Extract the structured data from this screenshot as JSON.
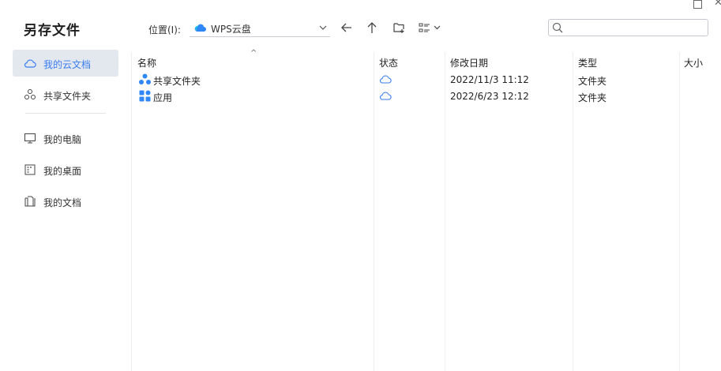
{
  "window": {
    "title": "另存文件"
  },
  "location": {
    "label": "位置(I):",
    "value": "WPS云盘"
  },
  "search": {
    "placeholder": "",
    "value": ""
  },
  "sidebar": {
    "items": [
      {
        "label": "我的云文档",
        "icon": "cloud-icon",
        "active": true
      },
      {
        "label": "共享文件夹",
        "icon": "share-icon",
        "active": false
      },
      {
        "label": "我的电脑",
        "icon": "computer-icon",
        "active": false
      },
      {
        "label": "我的桌面",
        "icon": "desktop-icon",
        "active": false
      },
      {
        "label": "我的文档",
        "icon": "documents-icon",
        "active": false
      }
    ]
  },
  "table": {
    "columns": [
      "名称",
      "状态",
      "修改日期",
      "类型",
      "大小"
    ],
    "rows": [
      {
        "name": "共享文件夹",
        "icon": "shared-folder-icon",
        "status": "cloud-icon",
        "date": "2022/11/3 11:12",
        "type": "文件夹",
        "size": ""
      },
      {
        "name": "应用",
        "icon": "apps-icon",
        "status": "cloud-icon",
        "date": "2022/6/23 12:12",
        "type": "文件夹",
        "size": ""
      }
    ]
  },
  "colors": {
    "accent": "#3a7ef2",
    "active_bg": "#e3e7ee"
  }
}
